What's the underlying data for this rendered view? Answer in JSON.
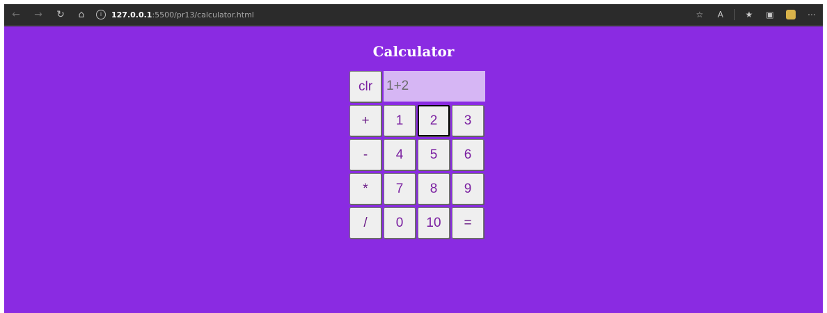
{
  "browser": {
    "url_host": "127.0.0.1",
    "url_path": ":5500/pr13/calculator.html",
    "icons": [
      "back-arrow-icon",
      "forward-arrow-icon",
      "refresh-icon",
      "home-icon",
      "info-icon",
      "add-favorite-icon",
      "read-aloud-icon",
      "favorites-icon",
      "collections-icon",
      "profile-icon",
      "more-icon"
    ]
  },
  "page": {
    "title": "Calculator",
    "background": "#8a2be2"
  },
  "calculator": {
    "clear_label": "clr",
    "display_value": "1+2",
    "rows": [
      [
        "+",
        "1",
        "2",
        "3"
      ],
      [
        "-",
        "4",
        "5",
        "6"
      ],
      [
        "*",
        "7",
        "8",
        "9"
      ],
      [
        "/",
        "0",
        "10",
        "="
      ]
    ]
  }
}
